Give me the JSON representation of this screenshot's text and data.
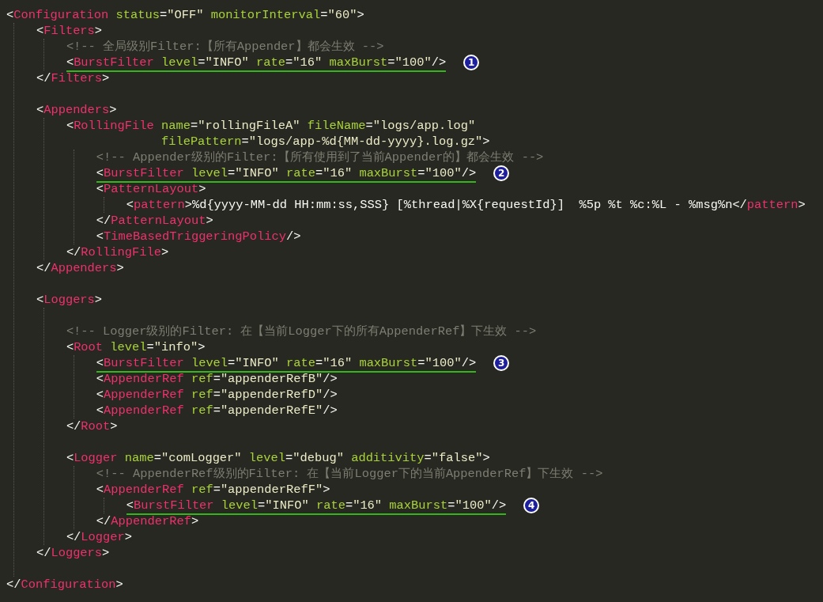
{
  "lines": [
    {
      "kind": "code",
      "tokens": [
        {
          "kind": "punct",
          "text": "<"
        },
        {
          "kind": "tag",
          "text": "Configuration"
        },
        {
          "kind": "attr",
          "text": " status"
        },
        {
          "kind": "punct",
          "text": "="
        },
        {
          "kind": "value",
          "text": "\"OFF\""
        },
        {
          "kind": "attr",
          "text": " monitorInterval"
        },
        {
          "kind": "punct",
          "text": "="
        },
        {
          "kind": "value",
          "text": "\"60\""
        },
        {
          "kind": "punct",
          "text": ">"
        }
      ],
      "children": [
        {
          "kind": "code",
          "tokens": [
            {
              "kind": "punct",
              "text": "<"
            },
            {
              "kind": "tag",
              "text": "Filters"
            },
            {
              "kind": "punct",
              "text": ">"
            }
          ],
          "children": [
            {
              "kind": "code",
              "tokens": [
                {
                  "kind": "comment",
                  "text": "<!-- 全局级别Filter:【所有Appender】都会生效 -->"
                }
              ]
            },
            {
              "kind": "code",
              "tokens": [
                {
                  "kind": "punct",
                  "text": "<"
                },
                {
                  "kind": "tag",
                  "text": "BurstFilter"
                },
                {
                  "kind": "attr",
                  "text": " level"
                },
                {
                  "kind": "punct",
                  "text": "="
                },
                {
                  "kind": "value",
                  "text": "\"INFO\""
                },
                {
                  "kind": "attr",
                  "text": " rate"
                },
                {
                  "kind": "punct",
                  "text": "="
                },
                {
                  "kind": "value",
                  "text": "\"16\""
                },
                {
                  "kind": "attr",
                  "text": " maxBurst"
                },
                {
                  "kind": "punct",
                  "text": "="
                },
                {
                  "kind": "value",
                  "text": "\"100\""
                },
                {
                  "kind": "punct",
                  "text": "/>"
                }
              ],
              "underlined": true,
              "marker": "1"
            }
          ]
        },
        {
          "kind": "code",
          "tokens": [
            {
              "kind": "punct",
              "text": "</"
            },
            {
              "kind": "tag",
              "text": "Filters"
            },
            {
              "kind": "punct",
              "text": ">"
            }
          ]
        },
        {
          "kind": "blank"
        },
        {
          "kind": "code",
          "tokens": [
            {
              "kind": "punct",
              "text": "<"
            },
            {
              "kind": "tag",
              "text": "Appenders"
            },
            {
              "kind": "punct",
              "text": ">"
            }
          ],
          "children": [
            {
              "kind": "code",
              "tokens": [
                {
                  "kind": "punct",
                  "text": "<"
                },
                {
                  "kind": "tag",
                  "text": "RollingFile"
                },
                {
                  "kind": "attr",
                  "text": " name"
                },
                {
                  "kind": "punct",
                  "text": "="
                },
                {
                  "kind": "value",
                  "text": "\"rollingFileA\""
                },
                {
                  "kind": "attr",
                  "text": " fileName"
                },
                {
                  "kind": "punct",
                  "text": "="
                },
                {
                  "kind": "value",
                  "text": "\"logs/app.log\""
                }
              ],
              "cont": [
                {
                  "kind": "attr",
                  "text": "filePattern"
                },
                {
                  "kind": "punct",
                  "text": "="
                },
                {
                  "kind": "value",
                  "text": "\"logs/app-%d{MM-dd-yyyy}.log.gz\""
                },
                {
                  "kind": "punct",
                  "text": ">"
                }
              ],
              "children": [
                {
                  "kind": "code",
                  "tokens": [
                    {
                      "kind": "comment",
                      "text": "<!-- Appender级别的Filter:【所有使用到了当前Appender的】都会生效 -->"
                    }
                  ]
                },
                {
                  "kind": "code",
                  "tokens": [
                    {
                      "kind": "punct",
                      "text": "<"
                    },
                    {
                      "kind": "tag",
                      "text": "BurstFilter"
                    },
                    {
                      "kind": "attr",
                      "text": " level"
                    },
                    {
                      "kind": "punct",
                      "text": "="
                    },
                    {
                      "kind": "value",
                      "text": "\"INFO\""
                    },
                    {
                      "kind": "attr",
                      "text": " rate"
                    },
                    {
                      "kind": "punct",
                      "text": "="
                    },
                    {
                      "kind": "value",
                      "text": "\"16\""
                    },
                    {
                      "kind": "attr",
                      "text": " maxBurst"
                    },
                    {
                      "kind": "punct",
                      "text": "="
                    },
                    {
                      "kind": "value",
                      "text": "\"100\""
                    },
                    {
                      "kind": "punct",
                      "text": "/>"
                    }
                  ],
                  "underlined": true,
                  "marker": "2"
                },
                {
                  "kind": "code",
                  "tokens": [
                    {
                      "kind": "punct",
                      "text": "<"
                    },
                    {
                      "kind": "tag",
                      "text": "PatternLayout"
                    },
                    {
                      "kind": "punct",
                      "text": ">"
                    }
                  ],
                  "children": [
                    {
                      "kind": "code",
                      "tokens": [
                        {
                          "kind": "punct",
                          "text": "<"
                        },
                        {
                          "kind": "tag",
                          "text": "pattern"
                        },
                        {
                          "kind": "punct",
                          "text": ">"
                        },
                        {
                          "kind": "text",
                          "text": "%d{yyyy-MM-dd HH:mm:ss,SSS} [%thread|%X{requestId}]  %5p %t %c:%L - %msg%n"
                        },
                        {
                          "kind": "punct",
                          "text": "</"
                        },
                        {
                          "kind": "tag",
                          "text": "pattern"
                        },
                        {
                          "kind": "punct",
                          "text": ">"
                        }
                      ]
                    }
                  ]
                },
                {
                  "kind": "code",
                  "tokens": [
                    {
                      "kind": "punct",
                      "text": "</"
                    },
                    {
                      "kind": "tag",
                      "text": "PatternLayout"
                    },
                    {
                      "kind": "punct",
                      "text": ">"
                    }
                  ]
                },
                {
                  "kind": "code",
                  "tokens": [
                    {
                      "kind": "punct",
                      "text": "<"
                    },
                    {
                      "kind": "tag",
                      "text": "TimeBasedTriggeringPolicy"
                    },
                    {
                      "kind": "punct",
                      "text": "/>"
                    }
                  ]
                }
              ]
            },
            {
              "kind": "code",
              "tokens": [
                {
                  "kind": "punct",
                  "text": "</"
                },
                {
                  "kind": "tag",
                  "text": "RollingFile"
                },
                {
                  "kind": "punct",
                  "text": ">"
                }
              ]
            }
          ]
        },
        {
          "kind": "code",
          "tokens": [
            {
              "kind": "punct",
              "text": "</"
            },
            {
              "kind": "tag",
              "text": "Appenders"
            },
            {
              "kind": "punct",
              "text": ">"
            }
          ]
        },
        {
          "kind": "blank"
        },
        {
          "kind": "code",
          "tokens": [
            {
              "kind": "punct",
              "text": "<"
            },
            {
              "kind": "tag",
              "text": "Loggers"
            },
            {
              "kind": "punct",
              "text": ">"
            }
          ],
          "children": [
            {
              "kind": "blank"
            },
            {
              "kind": "code",
              "tokens": [
                {
                  "kind": "comment",
                  "text": "<!-- Logger级别的Filter: 在【当前Logger下的所有AppenderRef】下生效 -->"
                }
              ]
            },
            {
              "kind": "code",
              "tokens": [
                {
                  "kind": "punct",
                  "text": "<"
                },
                {
                  "kind": "tag",
                  "text": "Root"
                },
                {
                  "kind": "attr",
                  "text": " level"
                },
                {
                  "kind": "punct",
                  "text": "="
                },
                {
                  "kind": "value",
                  "text": "\"info\""
                },
                {
                  "kind": "punct",
                  "text": ">"
                }
              ],
              "children": [
                {
                  "kind": "code",
                  "tokens": [
                    {
                      "kind": "punct",
                      "text": "<"
                    },
                    {
                      "kind": "tag",
                      "text": "BurstFilter"
                    },
                    {
                      "kind": "attr",
                      "text": " level"
                    },
                    {
                      "kind": "punct",
                      "text": "="
                    },
                    {
                      "kind": "value",
                      "text": "\"INFO\""
                    },
                    {
                      "kind": "attr",
                      "text": " rate"
                    },
                    {
                      "kind": "punct",
                      "text": "="
                    },
                    {
                      "kind": "value",
                      "text": "\"16\""
                    },
                    {
                      "kind": "attr",
                      "text": " maxBurst"
                    },
                    {
                      "kind": "punct",
                      "text": "="
                    },
                    {
                      "kind": "value",
                      "text": "\"100\""
                    },
                    {
                      "kind": "punct",
                      "text": "/>"
                    }
                  ],
                  "underlined": true,
                  "marker": "3"
                },
                {
                  "kind": "code",
                  "tokens": [
                    {
                      "kind": "punct",
                      "text": "<"
                    },
                    {
                      "kind": "tag",
                      "text": "AppenderRef"
                    },
                    {
                      "kind": "attr",
                      "text": " ref"
                    },
                    {
                      "kind": "punct",
                      "text": "="
                    },
                    {
                      "kind": "value",
                      "text": "\"appenderRefB\""
                    },
                    {
                      "kind": "punct",
                      "text": "/>"
                    }
                  ]
                },
                {
                  "kind": "code",
                  "tokens": [
                    {
                      "kind": "punct",
                      "text": "<"
                    },
                    {
                      "kind": "tag",
                      "text": "AppenderRef"
                    },
                    {
                      "kind": "attr",
                      "text": " ref"
                    },
                    {
                      "kind": "punct",
                      "text": "="
                    },
                    {
                      "kind": "value",
                      "text": "\"appenderRefD\""
                    },
                    {
                      "kind": "punct",
                      "text": "/>"
                    }
                  ]
                },
                {
                  "kind": "code",
                  "tokens": [
                    {
                      "kind": "punct",
                      "text": "<"
                    },
                    {
                      "kind": "tag",
                      "text": "AppenderRef"
                    },
                    {
                      "kind": "attr",
                      "text": " ref"
                    },
                    {
                      "kind": "punct",
                      "text": "="
                    },
                    {
                      "kind": "value",
                      "text": "\"appenderRefE\""
                    },
                    {
                      "kind": "punct",
                      "text": "/>"
                    }
                  ]
                }
              ]
            },
            {
              "kind": "code",
              "tokens": [
                {
                  "kind": "punct",
                  "text": "</"
                },
                {
                  "kind": "tag",
                  "text": "Root"
                },
                {
                  "kind": "punct",
                  "text": ">"
                }
              ]
            },
            {
              "kind": "blank"
            },
            {
              "kind": "code",
              "tokens": [
                {
                  "kind": "punct",
                  "text": "<"
                },
                {
                  "kind": "tag",
                  "text": "Logger"
                },
                {
                  "kind": "attr",
                  "text": " name"
                },
                {
                  "kind": "punct",
                  "text": "="
                },
                {
                  "kind": "value",
                  "text": "\"comLogger\""
                },
                {
                  "kind": "attr",
                  "text": " level"
                },
                {
                  "kind": "punct",
                  "text": "="
                },
                {
                  "kind": "value",
                  "text": "\"debug\""
                },
                {
                  "kind": "attr",
                  "text": " additivity"
                },
                {
                  "kind": "punct",
                  "text": "="
                },
                {
                  "kind": "value",
                  "text": "\"false\""
                },
                {
                  "kind": "punct",
                  "text": ">"
                }
              ],
              "children": [
                {
                  "kind": "code",
                  "tokens": [
                    {
                      "kind": "comment",
                      "text": "<!-- AppenderRef级别的Filter: 在【当前Logger下的当前AppenderRef】下生效 -->"
                    }
                  ]
                },
                {
                  "kind": "code",
                  "tokens": [
                    {
                      "kind": "punct",
                      "text": "<"
                    },
                    {
                      "kind": "tag",
                      "text": "AppenderRef"
                    },
                    {
                      "kind": "attr",
                      "text": " ref"
                    },
                    {
                      "kind": "punct",
                      "text": "="
                    },
                    {
                      "kind": "value",
                      "text": "\"appenderRefF\""
                    },
                    {
                      "kind": "punct",
                      "text": ">"
                    }
                  ],
                  "children": [
                    {
                      "kind": "code",
                      "tokens": [
                        {
                          "kind": "punct",
                          "text": "<"
                        },
                        {
                          "kind": "tag",
                          "text": "BurstFilter"
                        },
                        {
                          "kind": "attr",
                          "text": " level"
                        },
                        {
                          "kind": "punct",
                          "text": "="
                        },
                        {
                          "kind": "value",
                          "text": "\"INFO\""
                        },
                        {
                          "kind": "attr",
                          "text": " rate"
                        },
                        {
                          "kind": "punct",
                          "text": "="
                        },
                        {
                          "kind": "value",
                          "text": "\"16\""
                        },
                        {
                          "kind": "attr",
                          "text": " maxBurst"
                        },
                        {
                          "kind": "punct",
                          "text": "="
                        },
                        {
                          "kind": "value",
                          "text": "\"100\""
                        },
                        {
                          "kind": "punct",
                          "text": "/>"
                        }
                      ],
                      "underlined": true,
                      "marker": "4"
                    }
                  ]
                },
                {
                  "kind": "code",
                  "tokens": [
                    {
                      "kind": "punct",
                      "text": "</"
                    },
                    {
                      "kind": "tag",
                      "text": "AppenderRef"
                    },
                    {
                      "kind": "punct",
                      "text": ">"
                    }
                  ]
                }
              ]
            },
            {
              "kind": "code",
              "tokens": [
                {
                  "kind": "punct",
                  "text": "</"
                },
                {
                  "kind": "tag",
                  "text": "Logger"
                },
                {
                  "kind": "punct",
                  "text": ">"
                }
              ]
            }
          ]
        },
        {
          "kind": "code",
          "tokens": [
            {
              "kind": "punct",
              "text": "</"
            },
            {
              "kind": "tag",
              "text": "Loggers"
            },
            {
              "kind": "punct",
              "text": ">"
            }
          ]
        },
        {
          "kind": "blank"
        }
      ]
    },
    {
      "kind": "code",
      "tokens": [
        {
          "kind": "punct",
          "text": "</"
        },
        {
          "kind": "tag",
          "text": "Configuration"
        },
        {
          "kind": "punct",
          "text": ">"
        }
      ]
    }
  ]
}
